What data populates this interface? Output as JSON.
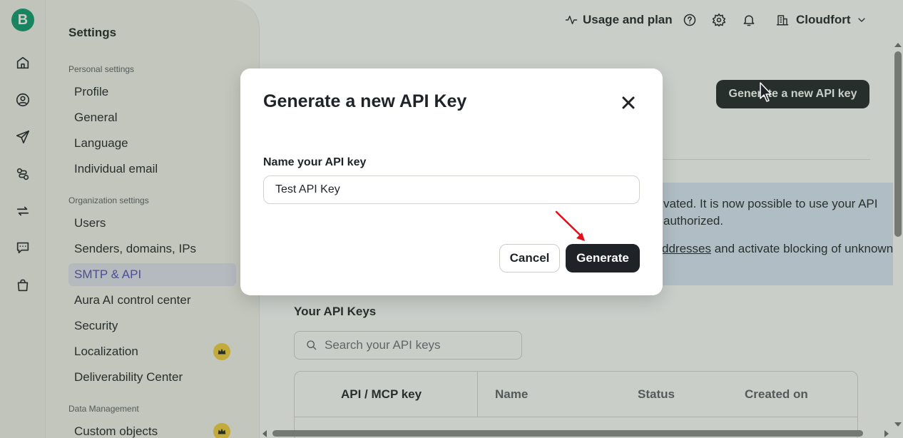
{
  "rail": {
    "brand_letter": "B",
    "icons": [
      "home-icon",
      "contacts-icon",
      "campaigns-icon",
      "automations-icon",
      "transactional-icon",
      "conversations-icon",
      "sales-icon"
    ]
  },
  "sidebar": {
    "title": "Settings",
    "sections": {
      "personal": "Personal settings",
      "organization": "Organization settings",
      "data": "Data Management"
    },
    "items": {
      "profile": "Profile",
      "general": "General",
      "language": "Language",
      "individual_email": "Individual email",
      "users": "Users",
      "senders": "Senders, domains, IPs",
      "smtp_api": "SMTP & API",
      "aura": "Aura AI control center",
      "security": "Security",
      "localization": "Localization",
      "deliverability": "Deliverability Center",
      "custom_objects": "Custom objects"
    },
    "active_item": "SMTP & API"
  },
  "topbar": {
    "usage_label": "Usage and plan",
    "org_name": "Cloudfort"
  },
  "main": {
    "generate_key_button": "Generate a new API key",
    "info": {
      "line1": "vated. It is now possible to use your API authorized.",
      "link_text": "ddresses",
      "line2_rest": " and activate blocking of unknown"
    },
    "keys_title": "Your API Keys",
    "search_placeholder": "Search your API keys",
    "table_headers": {
      "key": "API / MCP key",
      "name": "Name",
      "status": "Status",
      "created": "Created on"
    }
  },
  "modal": {
    "title": "Generate a new API Key",
    "field_label": "Name your API key",
    "field_value": "Test API Key",
    "cancel_label": "Cancel",
    "generate_label": "Generate"
  },
  "colors": {
    "brand": "#0b996e",
    "primary_button": "#1f2328",
    "active_nav_text": "#4f4fb8",
    "active_nav_bg": "#e4e4f1",
    "annotation_arrow": "#e3101b",
    "premium_badge": "#f5cf3a"
  }
}
